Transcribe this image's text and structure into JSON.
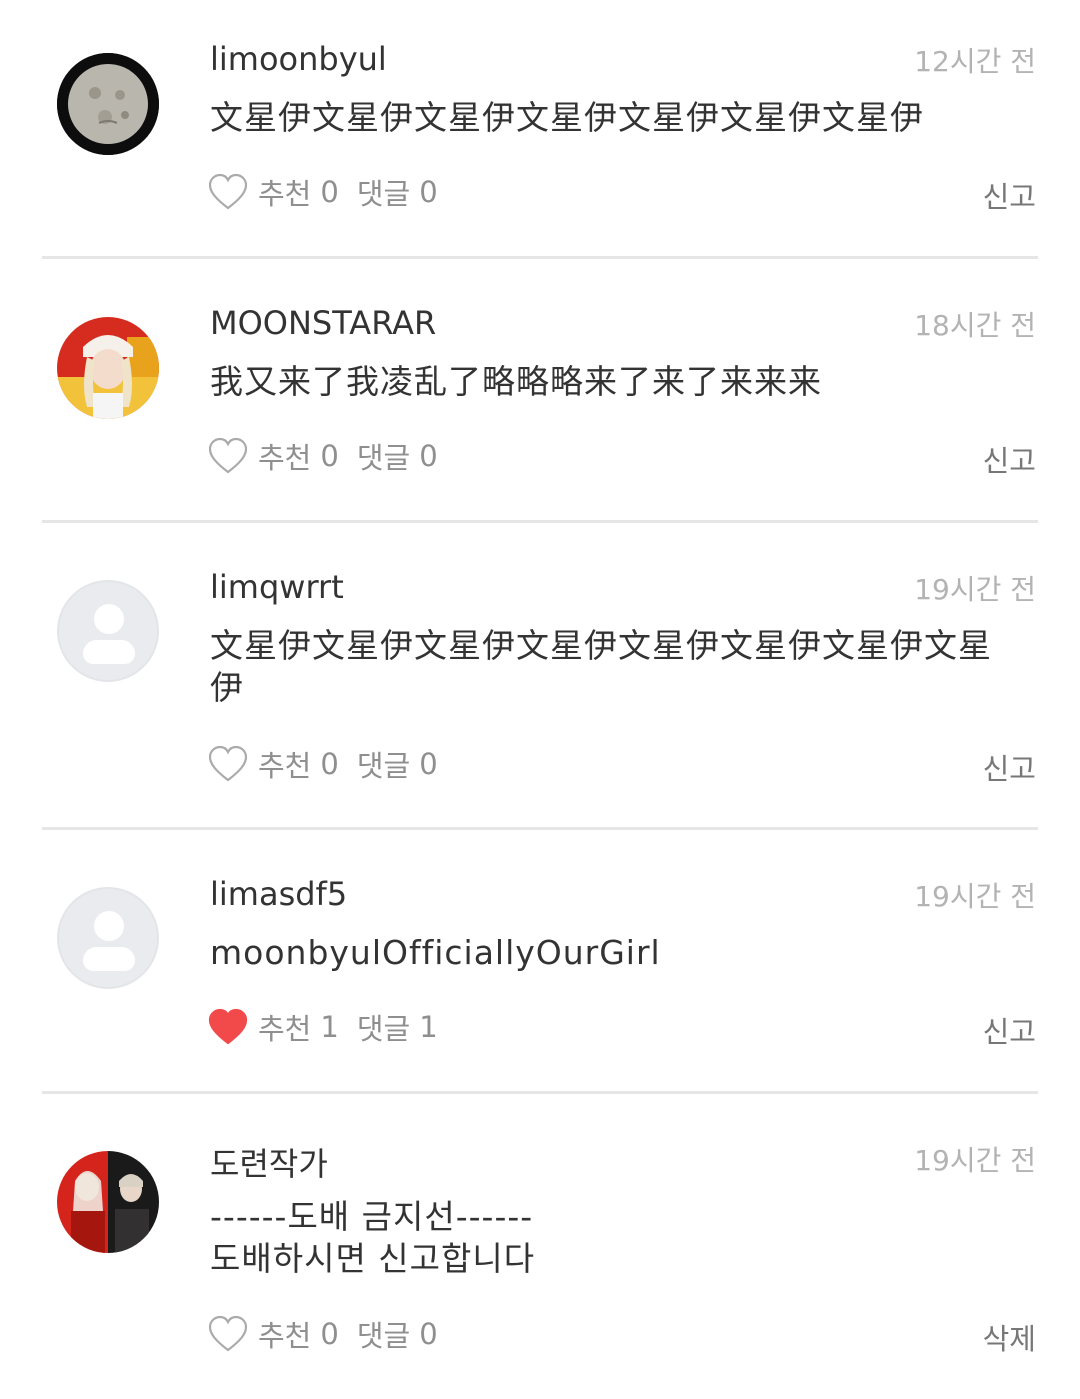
{
  "comments": [
    {
      "username": "limoonbyul",
      "time": "12시간 전",
      "lines": [
        "文星伊文星伊文星伊文星伊文星伊文星伊文星伊"
      ],
      "like_label": "추천",
      "likes": "0",
      "reply_label": "댓글",
      "replies": "0",
      "action": "신고",
      "liked": false,
      "avatar": "moon-photo"
    },
    {
      "username": "MOONSTARAR",
      "time": "18시간 전",
      "lines": [
        "我又来了我凌乱了略略略来了来了来来来"
      ],
      "like_label": "추천",
      "likes": "0",
      "reply_label": "댓글",
      "replies": "0",
      "action": "신고",
      "liked": false,
      "avatar": "user-photo"
    },
    {
      "username": "limqwrrt",
      "time": "19시간 전",
      "lines": [
        "文星伊文星伊文星伊文星伊文星伊文星伊文星伊文星",
        "伊"
      ],
      "like_label": "추천",
      "likes": "0",
      "reply_label": "댓글",
      "replies": "0",
      "action": "신고",
      "liked": false,
      "avatar": "default"
    },
    {
      "username": "limasdf5",
      "time": "19시간 전",
      "lines": [
        "moonbyulOfficiallyOurGirl"
      ],
      "like_label": "추천",
      "likes": "1",
      "reply_label": "댓글",
      "replies": "1",
      "action": "신고",
      "liked": true,
      "avatar": "default"
    },
    {
      "username": "도련작가",
      "time": "19시간 전",
      "lines": [
        "------도배 금지선------",
        "도배하시면 신고합니다"
      ],
      "like_label": "추천",
      "likes": "0",
      "reply_label": "댓글",
      "replies": "0",
      "action": "삭제",
      "liked": false,
      "avatar": "user-photo"
    }
  ],
  "colors": {
    "liked_heart": "#f24a4a",
    "heart_outline": "#aaaaaa",
    "divider": "#e6e6e6",
    "muted_text": "#8f8f8f"
  }
}
